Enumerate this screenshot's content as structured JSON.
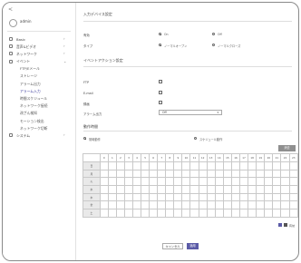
{
  "sidebar": {
    "back_label": "<",
    "user": "admin",
    "items": [
      {
        "label": "Basic",
        "chevron": "›"
      },
      {
        "label": "音声&ビデオ",
        "chevron": "›"
      },
      {
        "label": "ネットワーク",
        "chevron": "›"
      },
      {
        "label": "イベント",
        "chevron": "⌄"
      },
      {
        "label": "FTP/Eメール"
      },
      {
        "label": "ストレージ"
      },
      {
        "label": "アラーム出力"
      },
      {
        "label": "アラーム入力"
      },
      {
        "label": "時間スケジュール"
      },
      {
        "label": "ネットワーク接続"
      },
      {
        "label": "改ざん検知"
      },
      {
        "label": "モーション検出"
      },
      {
        "label": "ネットワーク切断"
      },
      {
        "label": "システム",
        "chevron": "›"
      }
    ]
  },
  "input_settings": {
    "title": "入力デバイス設定",
    "enable_label": "有効",
    "on_label": "On",
    "off_label": "Off",
    "type_label": "タイプ",
    "normal_open": "ノーマルオープン",
    "normal_close": "ノーマルクローズ"
  },
  "event_actions": {
    "title": "イベントアクション設定",
    "ftp_label": "FTP",
    "email_label": "E-mail",
    "record_label": "録画",
    "alarm_out_label": "アラーム出力",
    "alarm_out_value": "Off"
  },
  "activation_time": {
    "title": "動作時間",
    "always_label": "常時動作",
    "schedule_label": "スケジュール動作",
    "clear_button": "消去",
    "hours": [
      "0",
      "1",
      "2",
      "3",
      "4",
      "5",
      "6",
      "7",
      "8",
      "9",
      "10",
      "11",
      "12",
      "13",
      "14",
      "15",
      "16",
      "17",
      "18",
      "19",
      "20",
      "21",
      "22",
      "23"
    ],
    "days": [
      "日",
      "月",
      "火",
      "水",
      "木",
      "金",
      "土"
    ],
    "legend_label": "有効"
  },
  "footer": {
    "cancel_label": "キャンセル",
    "apply_label": "適用"
  },
  "colors": {
    "accent": "#5b5ba7",
    "grey_button": "#8f8f8f"
  }
}
